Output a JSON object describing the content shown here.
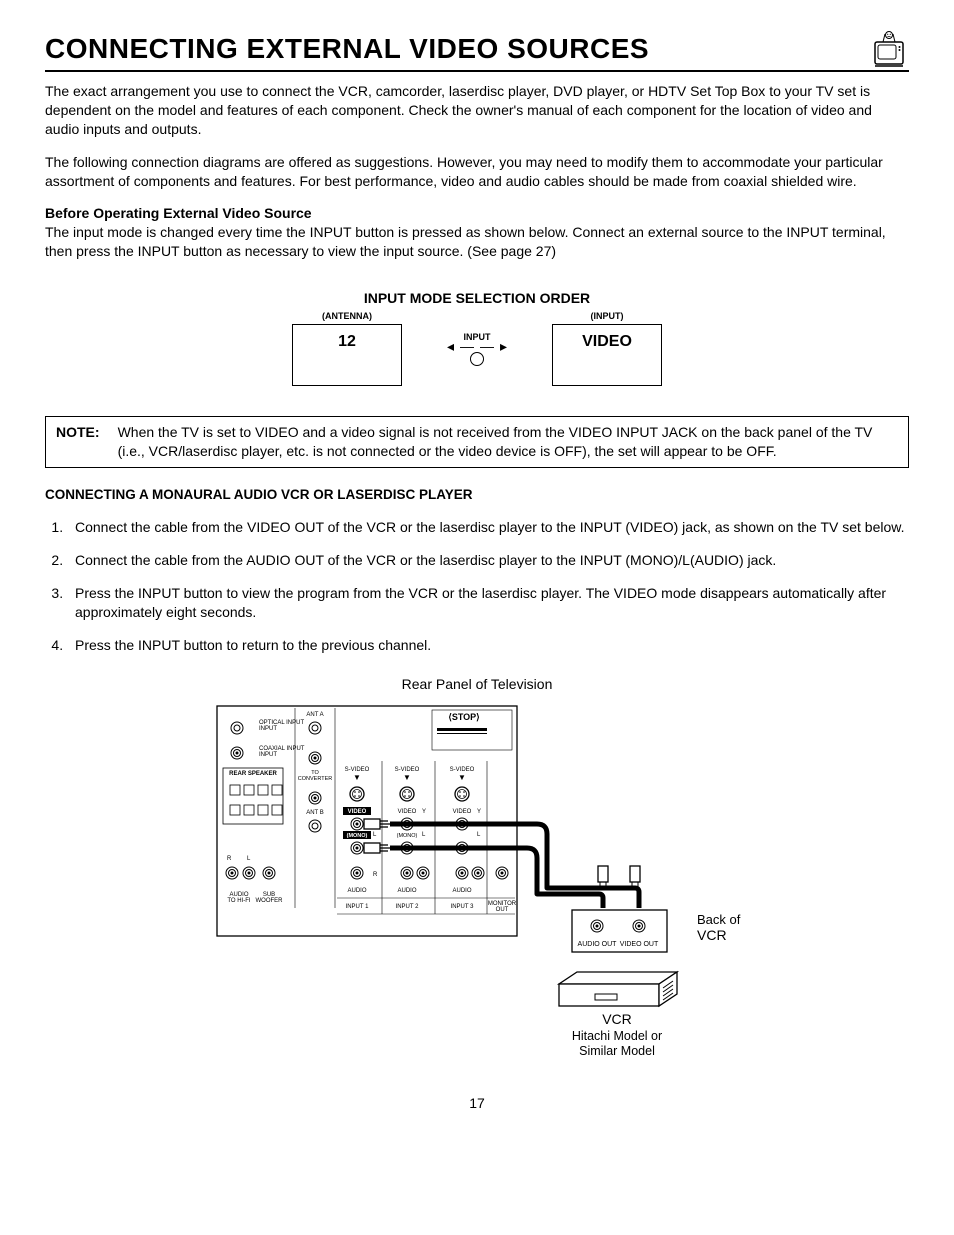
{
  "header": {
    "title": "Connecting External Video Sources"
  },
  "intro": {
    "p1": "The exact arrangement you use to connect the VCR, camcorder, laserdisc player, DVD player, or HDTV Set Top Box to your TV set is dependent on the model and features of each component.  Check the owner's manual of each component for the location of video and audio inputs and outputs.",
    "p2": "The following connection diagrams are offered as suggestions.  However, you may need to modify them to accommodate your particular assortment of components and features.  For best performance, video and audio cables should be made from coaxial shielded wire."
  },
  "before": {
    "heading": "Before Operating External Video Source",
    "body": "The input mode is changed every time the INPUT button is pressed as shown below.  Connect an external source to the INPUT terminal, then press the INPUT button as necessary to view the input source.  (See page 27)"
  },
  "input_diagram": {
    "title": "INPUT MODE SELECTION ORDER",
    "left_label": "(ANTENNA)",
    "left_value": "12",
    "button_label": "INPUT",
    "right_label": "(INPUT)",
    "right_value": "VIDEO"
  },
  "note": {
    "label": "NOTE:",
    "text": "When the TV is set to VIDEO and a video signal is not received from the VIDEO INPUT JACK on the back panel of the TV (i.e., VCR/laserdisc player, etc. is not connected or the video device is OFF), the set will appear to be OFF."
  },
  "section2": {
    "heading": "CONNECTING A MONAURAL AUDIO VCR OR LASERDISC PLAYER",
    "steps": [
      "Connect the cable from the VIDEO OUT of the VCR or the laserdisc player to the INPUT (VIDEO) jack, as shown on the TV set below.",
      "Connect the cable from the AUDIO OUT of the VCR or the laserdisc player to the INPUT (MONO)/L(AUDIO) jack.",
      "Press the INPUT button to view the program from the VCR or the laserdisc player.  The VIDEO mode disappears automatically after approximately eight seconds.",
      "Press the INPUT button to return to the previous channel."
    ]
  },
  "rear": {
    "caption": "Rear Panel of Television",
    "labels": {
      "stop": "STOP",
      "opt": "OPTICAL INPUT",
      "coax": "COAXIAL INPUT",
      "anta": "ANT A",
      "antb": "ANT B",
      "toconv": "TO CONVERTER",
      "rearspk": "REAR SPEAKER",
      "audiotohifi": "AUDIO TO HI-FI",
      "subwoofer": "SUB WOOFER",
      "svideo": "S-VIDEO",
      "video": "VIDEO",
      "mono": "(MONO)",
      "audio": "AUDIO",
      "input1": "INPUT 1",
      "input2": "INPUT 2",
      "input3": "INPUT 3",
      "monitorout": "MONITOR OUT",
      "r": "R",
      "l": "L",
      "y": "Y"
    },
    "vcr": {
      "back_of": "Back of",
      "vcr": "VCR",
      "audio_out": "AUDIO OUT",
      "video_out": "VIDEO OUT",
      "model": "Hitachi Model or",
      "model2": "Similar Model"
    }
  },
  "page_number": "17"
}
